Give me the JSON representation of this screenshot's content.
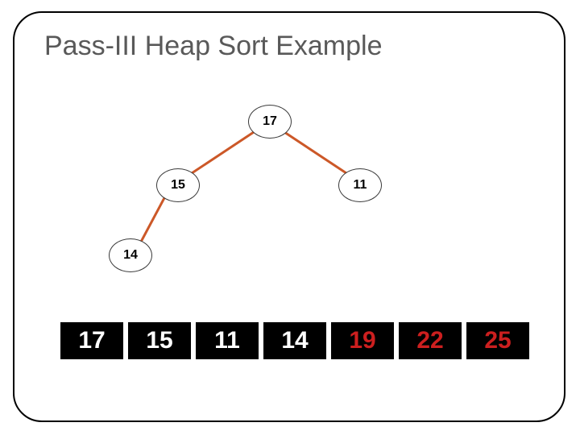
{
  "title": "Pass-III Heap Sort Example",
  "tree": {
    "root": "17",
    "left": "15",
    "right": "11",
    "leftLeft": "14"
  },
  "array": [
    {
      "value": "17",
      "colorClass": "cw"
    },
    {
      "value": "15",
      "colorClass": "cw"
    },
    {
      "value": "11",
      "colorClass": "cw"
    },
    {
      "value": "14",
      "colorClass": "cw"
    },
    {
      "value": "19",
      "colorClass": "cr"
    },
    {
      "value": "22",
      "colorClass": "cr"
    },
    {
      "value": "25",
      "colorClass": "cr"
    }
  ],
  "chart_data": {
    "type": "table",
    "title": "Pass-III Heap Sort Example",
    "heap_tree": {
      "nodes": [
        {
          "id": 0,
          "value": 17,
          "parent": null
        },
        {
          "id": 1,
          "value": 15,
          "parent": 0
        },
        {
          "id": 2,
          "value": 11,
          "parent": 0
        },
        {
          "id": 3,
          "value": 14,
          "parent": 1
        }
      ]
    },
    "array": {
      "values": [
        17,
        15,
        11,
        14,
        19,
        22,
        25
      ],
      "sorted_from_index": 4
    }
  }
}
